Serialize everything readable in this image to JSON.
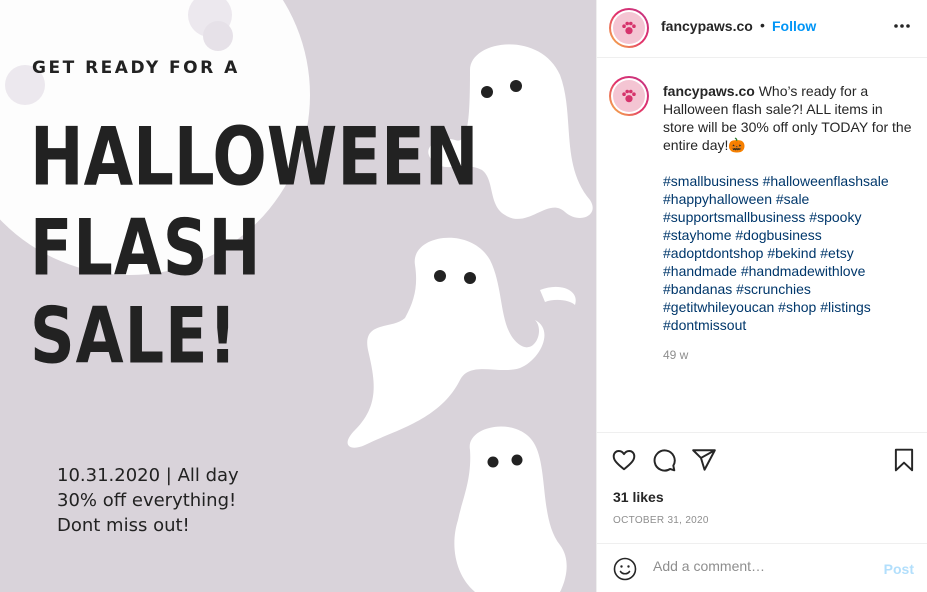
{
  "image": {
    "kicker": "GET READY FOR A",
    "headline": [
      "HALLOWEEN",
      "FLASH",
      "SALE!"
    ],
    "details": [
      "10.31.2020 | All day",
      "30% off everything!",
      "Dont miss out!"
    ],
    "colors": {
      "background": "#d9d3da",
      "moon": "#ffffff",
      "ghost": "#ffffff",
      "text": "#222222"
    }
  },
  "header": {
    "username": "fancypaws.co",
    "separator": "•",
    "follow_label": "Follow",
    "more_icon": "more-horizontal-icon"
  },
  "caption": {
    "username": "fancypaws.co",
    "text": " Who’s ready for a Halloween flash sale?! ALL items in store will be 30% off only TODAY for the entire day!🎃",
    "hashtag_lines": [
      "#smallbusiness #halloweenflashsale",
      "#happyhalloween #sale",
      "#supportsmallbusiness #spooky",
      "#stayhome #dogbusiness",
      "#adoptdontshop #bekind #etsy",
      "#handmade #handmadewithlove",
      "#bandanas #scrunchies",
      "#getitwhileyoucan #shop #listings",
      "#dontmissout"
    ],
    "age": "49 w"
  },
  "actions": {
    "icons": [
      "heart-icon",
      "comment-icon",
      "share-icon",
      "bookmark-icon"
    ],
    "likes": "31 likes",
    "date": "OCTOBER 31, 2020"
  },
  "comment": {
    "placeholder": "Add a comment…",
    "post_label": "Post",
    "colors": {
      "post_disabled": "#b2dffc",
      "link": "#00376b",
      "follow": "#0095f6"
    }
  }
}
